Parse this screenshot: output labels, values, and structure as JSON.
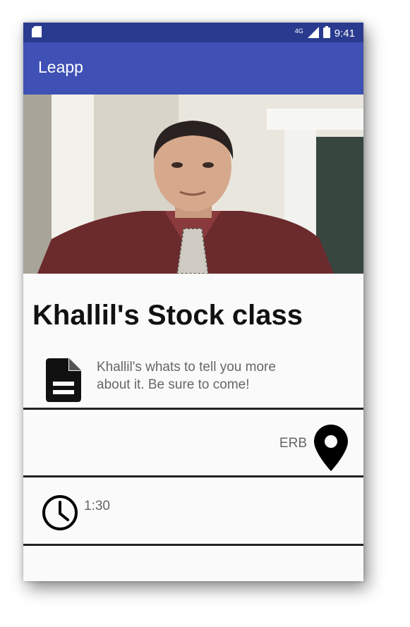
{
  "status_bar": {
    "network": "4G",
    "time": "9:41",
    "icons": [
      "sd-card-icon",
      "signal-icon",
      "battery-icon"
    ]
  },
  "app_bar": {
    "title": "Leapp"
  },
  "hero": {
    "icon": "profile-photo"
  },
  "event": {
    "title": "Khallil's Stock class",
    "description_lines": [
      "Khallil's whats to tell you more",
      "about it. Be sure to come!"
    ],
    "description_icon": "document-icon",
    "location": "ERB",
    "location_icon": "location-pin-icon",
    "time": "1:30",
    "time_icon": "clock-icon"
  },
  "colors": {
    "status_bar": "#2a3b8f",
    "app_bar": "#3f51b5",
    "background": "#fafafa"
  }
}
